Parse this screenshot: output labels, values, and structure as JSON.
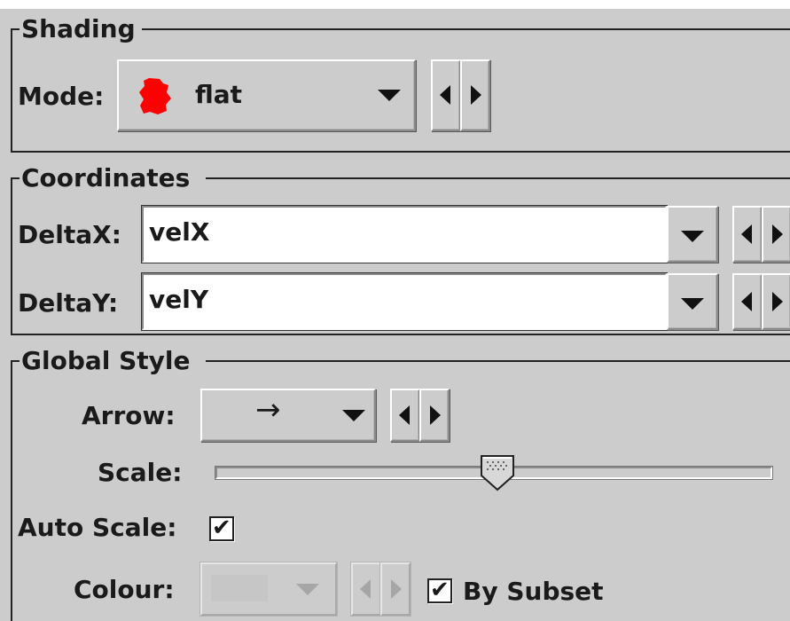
{
  "shading": {
    "group_title": "Shading",
    "mode_label": "Mode:",
    "mode_value": "flat",
    "mode_icon_color": "#ff0000"
  },
  "coordinates": {
    "group_title": "Coordinates",
    "deltax_label": "DeltaX:",
    "deltax_value": "velX",
    "deltay_label": "DeltaY:",
    "deltay_value": "velY"
  },
  "global_style": {
    "group_title": "Global Style",
    "arrow_label": "Arrow:",
    "arrow_value": "→",
    "scale_label": "Scale:",
    "scale_level": 0.5,
    "auto_scale_label": "Auto Scale:",
    "auto_scale_checked": "✔",
    "colour_label": "Colour:",
    "by_subset_label": "By Subset",
    "by_subset_checked": "✔"
  },
  "colors": {
    "panel_bg": "#cccccc",
    "accent_red": "#ff0000"
  }
}
